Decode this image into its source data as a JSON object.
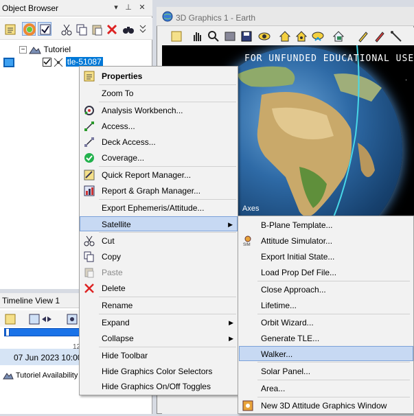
{
  "object_browser": {
    "title": "Object Browser",
    "tree": {
      "scenario": "Tutoriel",
      "satellite": "tle-51087"
    }
  },
  "timeline": {
    "title": "Timeline View 1",
    "date": "07 Jun 2023 10:00",
    "availability": "Tutoriel Availability",
    "tick": "12"
  },
  "graphics": {
    "title": "3D Graphics 1 - Earth",
    "banner": "FOR UNFUNDED EDUCATIONAL USE",
    "axes_label": "Axes"
  },
  "context_menu": {
    "items": [
      {
        "label": "Properties",
        "icon": "properties-icon",
        "bold": true
      },
      {
        "label": "Zoom To",
        "icon": ""
      },
      {
        "label": "Analysis Workbench...",
        "icon": "workbench-icon"
      },
      {
        "label": "Access...",
        "icon": "access-icon"
      },
      {
        "label": "Deck Access...",
        "icon": "deck-access-icon"
      },
      {
        "label": "Coverage...",
        "icon": "coverage-icon"
      },
      {
        "label": "Quick Report Manager...",
        "icon": "report-icon"
      },
      {
        "label": "Report & Graph Manager...",
        "icon": "graph-icon"
      },
      {
        "label": "Export Ephemeris/Attitude...",
        "icon": ""
      },
      {
        "label": "Satellite",
        "icon": "",
        "submenu": true
      },
      {
        "label": "Cut",
        "icon": "cut-icon"
      },
      {
        "label": "Copy",
        "icon": "copy-icon"
      },
      {
        "label": "Paste",
        "icon": "paste-icon"
      },
      {
        "label": "Delete",
        "icon": "delete-icon"
      },
      {
        "label": "Rename",
        "icon": ""
      },
      {
        "label": "Expand",
        "icon": "",
        "submenu": true
      },
      {
        "label": "Collapse",
        "icon": "",
        "submenu": true
      },
      {
        "label": "Hide Toolbar",
        "icon": ""
      },
      {
        "label": "Hide Graphics Color Selectors",
        "icon": ""
      },
      {
        "label": "Hide Graphics On/Off Toggles",
        "icon": ""
      }
    ]
  },
  "submenu": {
    "items": [
      {
        "label": "B-Plane Template...",
        "icon": ""
      },
      {
        "label": "Attitude Simulator...",
        "icon": "attitude-sim-icon"
      },
      {
        "label": "Export Initial State...",
        "icon": ""
      },
      {
        "label": "Load Prop Def File...",
        "icon": ""
      },
      {
        "label": "Close Approach...",
        "icon": ""
      },
      {
        "label": "Lifetime...",
        "icon": ""
      },
      {
        "label": "Orbit Wizard...",
        "icon": ""
      },
      {
        "label": "Generate TLE...",
        "icon": ""
      },
      {
        "label": "Walker...",
        "icon": ""
      },
      {
        "label": "Solar Panel...",
        "icon": ""
      },
      {
        "label": "Area...",
        "icon": ""
      },
      {
        "label": "New 3D Attitude Graphics Window",
        "icon": "attitude-window-icon"
      }
    ]
  },
  "colors": {
    "selection": "#0078d7",
    "menu_highlight": "#c7d9f3",
    "timeline_bar": "#1a73e8"
  }
}
